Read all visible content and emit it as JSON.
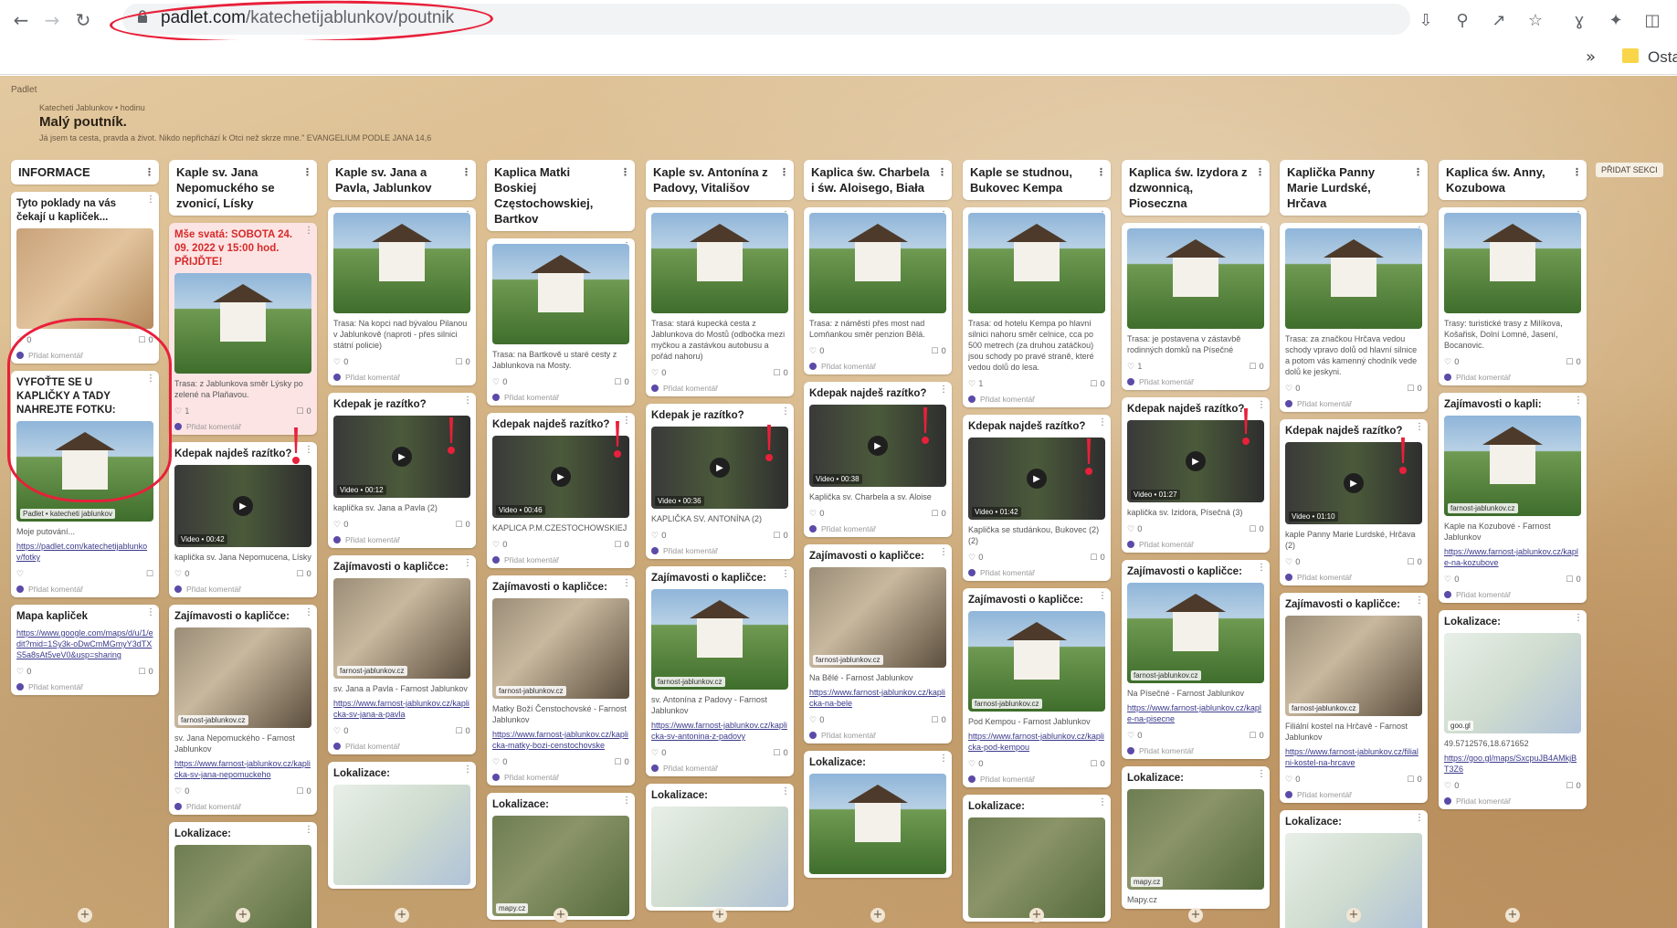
{
  "browser": {
    "url_host": "padlet.com",
    "url_path": "/katechetijablunkov/poutnik",
    "bookmarks_label": "Osta"
  },
  "wall": {
    "badge": "Padlet",
    "author": "Katecheti Jablunkov • hodinu",
    "title": "Malý poutník.",
    "description": "Já jsem ta cesta, pravda a život. Nikdo nepřichází k Otci než skrze mne.\" EVANGELIUM PODLE JANA 14,6",
    "add_section": "PŘIDAT SEKCI"
  },
  "columns": [
    {
      "title": "INFORMACE",
      "cards": [
        {
          "title": "Tyto poklady na vás čekají u kapliček...",
          "img": "jars",
          "likes": "0",
          "comments": "0",
          "comment_label": "Přidat komentář"
        },
        {
          "title": "VYFOŤTE SE U KAPLIČKY A TADY NAHREJTE FOTKU:",
          "img": "photo",
          "tag": "Padlet • katecheti jablunkov",
          "text": "Moje putování...",
          "link": "https://padlet.com/katechetijablunkov/fotky",
          "likes": "",
          "comments": "",
          "comment_label": "Přidat komentář"
        },
        {
          "title": "Mapa kapliček",
          "link": "https://www.google.com/maps/d/u/1/edit?mid=1Sy3k-oDwCmMGmyY3dTXS5a8sAt5veV0&usp=sharing",
          "likes": "0",
          "comments": "0",
          "comment_label": "Přidat komentář"
        }
      ]
    },
    {
      "title": "Kaple sv. Jana Nepomuckého se zvonicí, Lísky",
      "cards": [
        {
          "title": "Mše svatá: SOBOTA 24. 09. 2022 v 15:00 hod. PŘIJĎTE!",
          "red_title": true,
          "pink": true,
          "img": "photo",
          "text": "Trasa: z Jablunkova směr Lýsky po zelené na Plaňavou.",
          "likes": "1",
          "comments": "0",
          "comment_label": "Přidat komentář"
        },
        {
          "title": "Kdepak najdeš razítko?",
          "img": "video",
          "video": "Video • 00:42",
          "text": "kaplička sv. Jana Nepomucena, Lísky",
          "likes": "0",
          "comments": "0",
          "comment_label": "Přidat komentář"
        },
        {
          "title": "Zajímavosti o kapličce:",
          "img": "bike",
          "tag": "farnost-jablunkov.cz",
          "text": "sv. Jana Nepomuckého - Farnost Jablunkov",
          "link": "https://www.farnost-jablunkov.cz/kaplicka-sv-jana-nepomuckeho",
          "likes": "0",
          "comments": "0",
          "comment_label": "Přidat komentář"
        },
        {
          "title": "Lokalizace:",
          "img": "sat"
        }
      ]
    },
    {
      "title": "Kaple sv. Jana a Pavla, Jablunkov",
      "cards": [
        {
          "title": "",
          "img": "photo",
          "text": "Trasa: Na kopci nad bývalou Pilanou v Jablunkově (naproti - přes silnici státní policie)",
          "likes": "0",
          "comments": "0",
          "comment_label": "Přidat komentář"
        },
        {
          "title": "Kdepak je razítko?",
          "img": "video",
          "video": "Video • 00:12",
          "text": "kaplička sv. Jana a Pavla (2)",
          "likes": "0",
          "comments": "0",
          "comment_label": "Přidat komentář"
        },
        {
          "title": "Zajímavosti o kapličce:",
          "img": "bike",
          "tag": "farnost-jablunkov.cz",
          "text": "sv. Jana a Pavla - Farnost Jablunkov",
          "link": "https://www.farnost-jablunkov.cz/kaplicka-sv-jana-a-pavla",
          "likes": "0",
          "comments": "0",
          "comment_label": "Přidat komentář"
        },
        {
          "title": "Lokalizace:",
          "img": "map"
        }
      ]
    },
    {
      "title": "Kaplica Matki Boskiej Częstochowskiej, Bartkov",
      "cards": [
        {
          "title": "",
          "img": "photo",
          "text": "Trasa: na Bartkově u staré cesty z Jablunkova na Mosty.",
          "likes": "0",
          "comments": "0",
          "comment_label": "Přidat komentář"
        },
        {
          "title": "Kdepak najdeš razítko?",
          "img": "video",
          "video": "Video • 00:46",
          "text": "KAPLICA P.M.CZESTOCHOWSKIEJ",
          "likes": "0",
          "comments": "0",
          "comment_label": "Přidat komentář"
        },
        {
          "title": "Zajímavosti o kapličce:",
          "img": "bike",
          "tag": "farnost-jablunkov.cz",
          "text": "Matky Boží Čenstochovské - Farnost Jablunkov",
          "link": "https://www.farnost-jablunkov.cz/kaplicka-matky-bozi-censtochovske",
          "likes": "0",
          "comments": "0",
          "comment_label": "Přidat komentář"
        },
        {
          "title": "Lokalizace:",
          "img": "sat",
          "tag": "mapy.cz"
        }
      ]
    },
    {
      "title": "Kaple sv. Antonína z Padovy, Vitališov",
      "cards": [
        {
          "title": "",
          "img": "photo",
          "text": "Trasa: stará kupecká cesta z Jablunkova do Mostů (odbočka mezi myčkou a zastávkou autobusu a pořád nahoru)",
          "likes": "0",
          "comments": "0",
          "comment_label": "Přidat komentář"
        },
        {
          "title": "Kdepak je razítko?",
          "img": "video",
          "video": "Video • 00:36",
          "text": "KAPLIČKA SV. ANTONÍNA (2)",
          "likes": "0",
          "comments": "0",
          "comment_label": "Přidat komentář"
        },
        {
          "title": "Zajímavosti o kapličce:",
          "img": "photo",
          "tag": "farnost-jablunkov.cz",
          "text": "sv. Antonína z Padovy - Farnost Jablunkov",
          "link": "https://www.farnost-jablunkov.cz/kaplicka-sv-antonina-z-padovy",
          "likes": "0",
          "comments": "0",
          "comment_label": "Přidat komentář"
        },
        {
          "title": "Lokalizace:",
          "img": "map"
        }
      ]
    },
    {
      "title": "Kaplica św. Charbela i św. Aloisego, Biała",
      "cards": [
        {
          "title": "",
          "img": "photo",
          "text": "Trasa: z náměstí přes most nad Lomňankou směr penzion Bělá.",
          "likes": "0",
          "comments": "0",
          "comment_label": "Přidat komentář"
        },
        {
          "title": "Kdepak najdeš razítko?",
          "img": "video",
          "video": "Video • 00:38",
          "text": "Kaplička sv. Charbela a sv. Aloise",
          "likes": "0",
          "comments": "0",
          "comment_label": "Přidat komentář"
        },
        {
          "title": "Zajímavosti o kapličce:",
          "img": "bike",
          "tag": "farnost-jablunkov.cz",
          "text": "Na Bělé - Farnost Jablunkov",
          "link": "https://www.farnost-jablunkov.cz/kaplicka-na-bele",
          "likes": "0",
          "comments": "0",
          "comment_label": "Přidat komentář"
        },
        {
          "title": "Lokalizace:",
          "img": "photo"
        }
      ]
    },
    {
      "title": "Kaple se studnou, Bukovec Kempa",
      "cards": [
        {
          "title": "",
          "img": "photo",
          "text": "Trasa: od hotelu Kempa po hlavní silnici nahoru směr celnice, cca po 500 metrech (za druhou zatáčkou) jsou schody po pravé straně, které vedou dolů do lesa.",
          "likes": "1",
          "comments": "0",
          "comment_label": "Přidat komentář"
        },
        {
          "title": "Kdepak najdeš razítko?",
          "img": "video",
          "video": "Video • 01:42",
          "text": "Kaplička se studánkou, Bukovec (2) (2)",
          "likes": "0",
          "comments": "0",
          "comment_label": "Přidat komentář"
        },
        {
          "title": "Zajímavosti o kapličce:",
          "img": "photo",
          "tag": "farnost-jablunkov.cz",
          "text": "Pod Kempou - Farnost Jablunkov",
          "link": "https://www.farnost-jablunkov.cz/kaplicka-pod-kempou",
          "likes": "0",
          "comments": "0",
          "comment_label": "Přidat komentář"
        },
        {
          "title": "Lokalizace:",
          "img": "sat"
        }
      ]
    },
    {
      "title": "Kaplica św. Izydora z dzwonnicą, Pioseczna",
      "cards": [
        {
          "title": "",
          "img": "photo",
          "text": "Trasa: je postavena v zástavbě rodinných domků na Písečné",
          "likes": "1",
          "comments": "0",
          "comment_label": "Přidat komentář"
        },
        {
          "title": "Kdepak najdeš razítko?",
          "img": "video",
          "video": "Video • 01:27",
          "text": "kaplička sv. Izidora, Písečná (3)",
          "likes": "0",
          "comments": "0",
          "comment_label": "Přidat komentář"
        },
        {
          "title": "Zajímavosti o kapličce:",
          "img": "photo",
          "tag": "farnost-jablunkov.cz",
          "text": "Na Písečné - Farnost Jablunkov",
          "link": "https://www.farnost-jablunkov.cz/kaple-na-pisecne",
          "likes": "0",
          "comments": "0",
          "comment_label": "Přidat komentář"
        },
        {
          "title": "Lokalizace:",
          "img": "sat",
          "tag": "mapy.cz",
          "text": "Mapy.cz"
        }
      ]
    },
    {
      "title": "Kaplička Panny Marie Lurdské, Hrčava",
      "cards": [
        {
          "title": "",
          "img": "photo",
          "text": "Trasa: za značkou Hrčava vedou schody vpravo dolů od hlavní silnice a potom vás kamenný chodník vede dolů ke jeskyni.",
          "likes": "0",
          "comments": "0",
          "comment_label": "Přidat komentář"
        },
        {
          "title": "Kdepak najdeš razítko?",
          "img": "video",
          "video": "Video • 01:10",
          "text": "kaple Panny Marie Lurdské, Hrčava (2)",
          "likes": "0",
          "comments": "0",
          "comment_label": "Přidat komentář"
        },
        {
          "title": "Zajímavosti o kapličce:",
          "img": "bike",
          "tag": "farnost-jablunkov.cz",
          "text": "Filiální kostel na Hrčavě - Farnost Jablunkov",
          "link": "https://www.farnost-jablunkov.cz/filialni-kostel-na-hrcave",
          "likes": "0",
          "comments": "0",
          "comment_label": "Přidat komentář"
        },
        {
          "title": "Lokalizace:",
          "img": "map"
        }
      ]
    },
    {
      "title": "Kaplica św. Anny, Kozubowa",
      "cards": [
        {
          "title": "",
          "img": "photo",
          "text": "Trasy: turistické trasy z Milíkova, Košařisk, Dolní Lomné, Jasení, Bocanovic.",
          "likes": "0",
          "comments": "0",
          "comment_label": "Přidat komentář"
        },
        {
          "title": "Zajímavosti o kapli:",
          "img": "photo",
          "tag": "farnost-jablunkov.cz",
          "text": "Kaple na Kozubové - Farnost Jablunkov",
          "link": "https://www.farnost-jablunkov.cz/kaple-na-kozubove",
          "likes": "0",
          "comments": "0",
          "comment_label": "Přidat komentář"
        },
        {
          "title": "Lokalizace:",
          "img": "map",
          "tag": "goo.gl",
          "text": "49.5712576,18.671652",
          "link": "https://goo.gl/maps/SxcpuJB4AMkjBT3Z6",
          "likes": "0",
          "comments": "0",
          "comment_label": "Přidat komentář"
        }
      ]
    }
  ],
  "icons": {
    "back": "back-arrow-icon",
    "forward": "forward-arrow-icon",
    "reload": "reload-icon",
    "lock": "lock-icon",
    "install": "install-icon",
    "zoom": "zoom-icon",
    "share": "share-icon",
    "star": "star-icon",
    "extension": "puzzle-icon",
    "sidepanel": "side-panel-icon"
  },
  "colors": {
    "annotation_red": "#e8203a",
    "pink_card": "#fde4e4",
    "avatar": "#5c4aa8"
  }
}
